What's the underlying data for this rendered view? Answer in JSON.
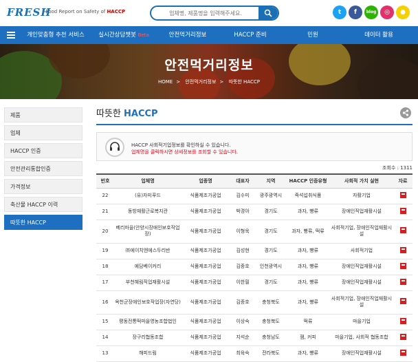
{
  "header": {
    "logo": "FRESH",
    "tagline_prefix": "· Food Report on Safety of ",
    "tagline_brand": "HACCP",
    "search_placeholder": "업체명, 제품명을 입력해주세요.",
    "social": [
      {
        "name": "twitter-icon",
        "glyph": "t",
        "color": "#1da1f2"
      },
      {
        "name": "facebook-icon",
        "glyph": "f",
        "color": "#3b5998"
      },
      {
        "name": "blog-icon",
        "glyph": "blog",
        "color": "#2db400"
      },
      {
        "name": "instagram-icon",
        "glyph": "◎",
        "color": "#e1306c"
      },
      {
        "name": "kakao-icon",
        "glyph": "●",
        "color": "#f7d000"
      }
    ]
  },
  "nav": {
    "items": [
      {
        "label": "개인맞춤형 추천 서비스"
      },
      {
        "label": "실시간상담챗봇",
        "badge": "Beta"
      },
      {
        "label": "안전먹거리정보"
      },
      {
        "label": "HACCP 준비"
      },
      {
        "label": "민원"
      },
      {
        "label": "데이터 활용"
      }
    ]
  },
  "banner": {
    "title": "안전먹거리정보",
    "breadcrumb": [
      "HOME",
      "안전먹거리정보",
      "따뜻한 HACCP"
    ]
  },
  "sidebar": {
    "items": [
      {
        "label": "제품",
        "active": false
      },
      {
        "label": "업체",
        "active": false
      },
      {
        "label": "HACCP 인증",
        "active": false
      },
      {
        "label": "안전관리통합인증",
        "active": false
      },
      {
        "label": "가격정보",
        "active": false
      },
      {
        "label": "축산물 HACCP 이력",
        "active": false
      },
      {
        "label": "따뜻한 HACCP",
        "active": true
      }
    ]
  },
  "main": {
    "title_prefix": "따뜻한",
    "title_main": "HACCP",
    "notice_line1": "HACCP 사회적기업정보를 확인하실 수 있습니다.",
    "notice_line2": "업체명을 클릭하시면 상세정보를 조회할 수 있습니다.",
    "total": "조회수 : 1311",
    "columns": [
      "번호",
      "업체명",
      "업종명",
      "대표자",
      "지역",
      "HACCP 인증유형",
      "사회적 가치 실현",
      "자료"
    ],
    "rows": [
      {
        "no": "22",
        "company": "(유)자미푸드",
        "industry": "식품제조가공업",
        "ceo": "김수미",
        "region": "광주광역시",
        "type": "즉석섭취식품",
        "value": "자활기업",
        "tall": false
      },
      {
        "no": "21",
        "company": "동방재활근로복지관",
        "industry": "식품제조가공업",
        "ceo": "박경아",
        "region": "경기도",
        "type": "과자, 빵류",
        "value": "장애인직업재활시설",
        "tall": false
      },
      {
        "no": "20",
        "company": "베리마을(안양시장애인보호작업장)",
        "industry": "식품제조가공업",
        "ceo": "이형욱",
        "region": "경기도",
        "type": "과자, 빵류, 떡류",
        "value": "사회적기업, 장애인직업재활시설",
        "tall": true
      },
      {
        "no": "19",
        "company": "㈜에이치엔에스두리반",
        "industry": "식품제조가공업",
        "ceo": "김성현",
        "region": "경기도",
        "type": "과자, 빵류",
        "value": "사회적기업",
        "tall": false
      },
      {
        "no": "18",
        "company": "예담베이커리",
        "industry": "식품제조가공업",
        "ceo": "김종호",
        "region": "인천광역시",
        "type": "과자, 빵류",
        "value": "장애인직업재활시설",
        "tall": false
      },
      {
        "no": "17",
        "company": "부천혜림직업재활시설",
        "industry": "식품제조가공업",
        "ceo": "이한필",
        "region": "경기도",
        "type": "과자, 빵류",
        "value": "장애인직업재활시설",
        "tall": false
      },
      {
        "no": "16",
        "company": "옥천군장애인보호작업장(자연당)",
        "industry": "식품제조가공업",
        "ceo": "김종호",
        "region": "충청북도",
        "type": "과자, 빵류",
        "value": "사회적기업, 장애인직업재활시설",
        "tall": true
      },
      {
        "no": "15",
        "company": "평동전통떡마을영농조합법인",
        "industry": "식품제조가공업",
        "ceo": "이상숙",
        "region": "충청북도",
        "type": "떡류",
        "value": "마을기업",
        "tall": false
      },
      {
        "no": "14",
        "company": "장구리협동조합",
        "industry": "식품제조가공업",
        "ceo": "지석순",
        "region": "충청남도",
        "type": "잼, 커피",
        "value": "마을기업, 사회적 협동조합",
        "tall": false
      },
      {
        "no": "13",
        "company": "해피드림",
        "industry": "식품제조가공업",
        "ceo": "최육숙",
        "region": "전라북도",
        "type": "과자, 빵류",
        "value": "장애인직업재활시설",
        "tall": false
      }
    ]
  }
}
